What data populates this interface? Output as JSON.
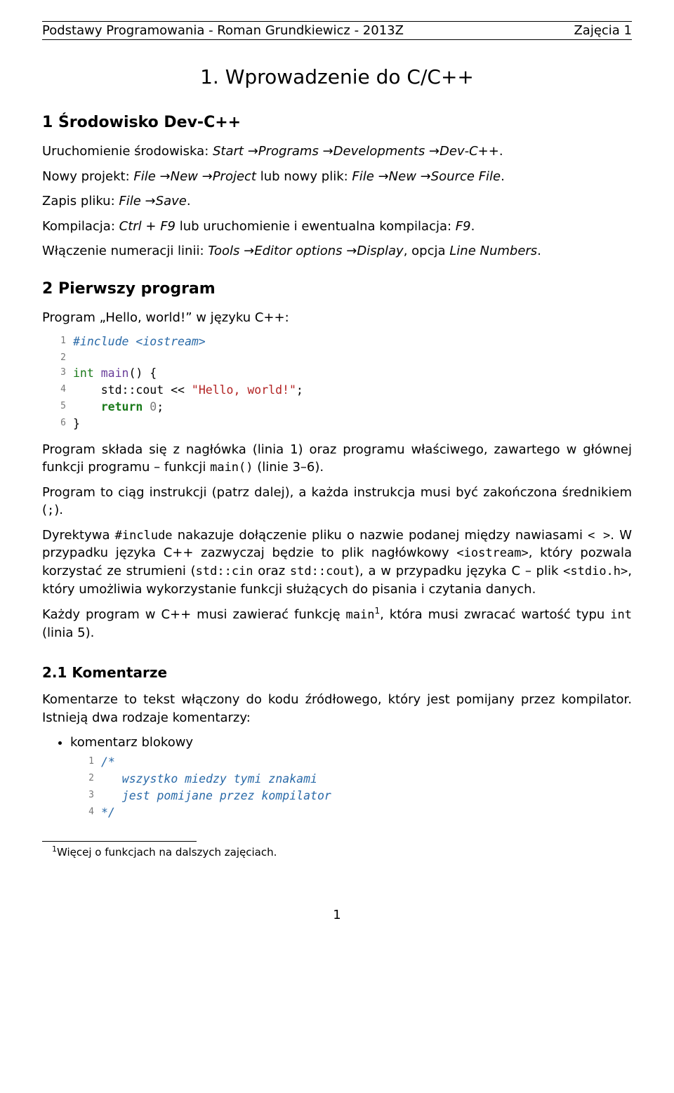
{
  "header": {
    "left": "Podstawy Programowania - Roman Grundkiewicz - 2013Z",
    "right": "Zajęcia 1"
  },
  "title": "1. Wprowadzenie do C/C++",
  "sec1": {
    "heading": "1   Środowisko Dev-C++",
    "p1_a": "Uruchomienie środowiska: ",
    "p1_b": "Start",
    "p1_c": "Programs",
    "p1_d": "Developments",
    "p1_e": "Dev-C++",
    "p1_f": ".",
    "p2_a": "Nowy projekt: ",
    "p2_b": "File",
    "p2_c": "New",
    "p2_d": "Project",
    "p2_e": " lub nowy plik: ",
    "p2_f": "File",
    "p2_g": "New",
    "p2_h": "Source File",
    "p2_i": ".",
    "p3_a": "Zapis pliku: ",
    "p3_b": "File",
    "p3_c": "Save",
    "p3_d": ".",
    "p4_a": "Kompilacja: ",
    "p4_b": "Ctrl + F9",
    "p4_c": " lub uruchomienie i ewentualna kompilacja: ",
    "p4_d": "F9",
    "p4_e": ".",
    "p5_a": "Włączenie numeracji linii: ",
    "p5_b": "Tools",
    "p5_c": "Editor options",
    "p5_d": "Display",
    "p5_e": ", opcja ",
    "p5_f": "Line Numbers",
    "p5_g": "."
  },
  "sec2": {
    "heading": "2   Pierwszy program",
    "intro": "Program „Hello, world!” w języku C++:",
    "code": {
      "l1": "#include <iostream>",
      "l2": "",
      "l3a": "int",
      "l3b": " ",
      "l3c": "main",
      "l3d": "() {",
      "l4a": "    std::cout << ",
      "l4b": "\"Hello, world!\"",
      "l4c": ";",
      "l5a": "    ",
      "l5b": "return",
      "l5c": " ",
      "l5d": "0",
      "l5e": ";",
      "l6": "}"
    },
    "p6_a": "Program składa się z nagłówka (linia 1) oraz programu właściwego, zawartego w głównej funkcji programu – funkcji ",
    "p6_b": "main()",
    "p6_c": " (linie 3–6).",
    "p7_a": "Program to ciąg instrukcji (patrz dalej), a każda instrukcja musi być zakończona średnikiem (",
    "p7_b": ";",
    "p7_c": ").",
    "p8_a": "Dyrektywa ",
    "p8_b": "#include",
    "p8_c": " nakazuje dołączenie pliku o nazwie podanej między nawiasami ",
    "p8_d": "< >",
    "p8_e": ". W przypadku języka C++ zazwyczaj będzie to plik nagłówkowy ",
    "p8_f": "<iostream>",
    "p8_g": ", który pozwala korzystać ze strumieni (",
    "p8_h": "std::cin",
    "p8_i": " oraz ",
    "p8_j": "std::cout",
    "p8_k": "), a w przypadku języka C – plik ",
    "p8_l": "<stdio.h>",
    "p8_m": ", który umożliwia wykorzystanie funkcji służących do pisania i czytania danych.",
    "p9_a": "Każdy program w C++ musi zawierać funkcję ",
    "p9_b": "main",
    "p9_c": ", która musi zwracać wartość typu ",
    "p9_d": "int",
    "p9_e": " (linia 5)."
  },
  "sec21": {
    "heading": "2.1   Komentarze",
    "intro": "Komentarze to tekst włączony do kodu źródłowego, który jest pomijany przez kompilator. Istnieją dwa rodzaje komentarzy:",
    "bullet": "komentarz blokowy",
    "code": {
      "l1": "/*",
      "l2": "   wszystko miedzy tymi znakami",
      "l3": "   jest pomijane przez kompilator",
      "l4": "*/"
    }
  },
  "footnote": {
    "marker": "1",
    "text": "Więcej o funkcjach na dalszych zajęciach."
  },
  "page_number": "1"
}
